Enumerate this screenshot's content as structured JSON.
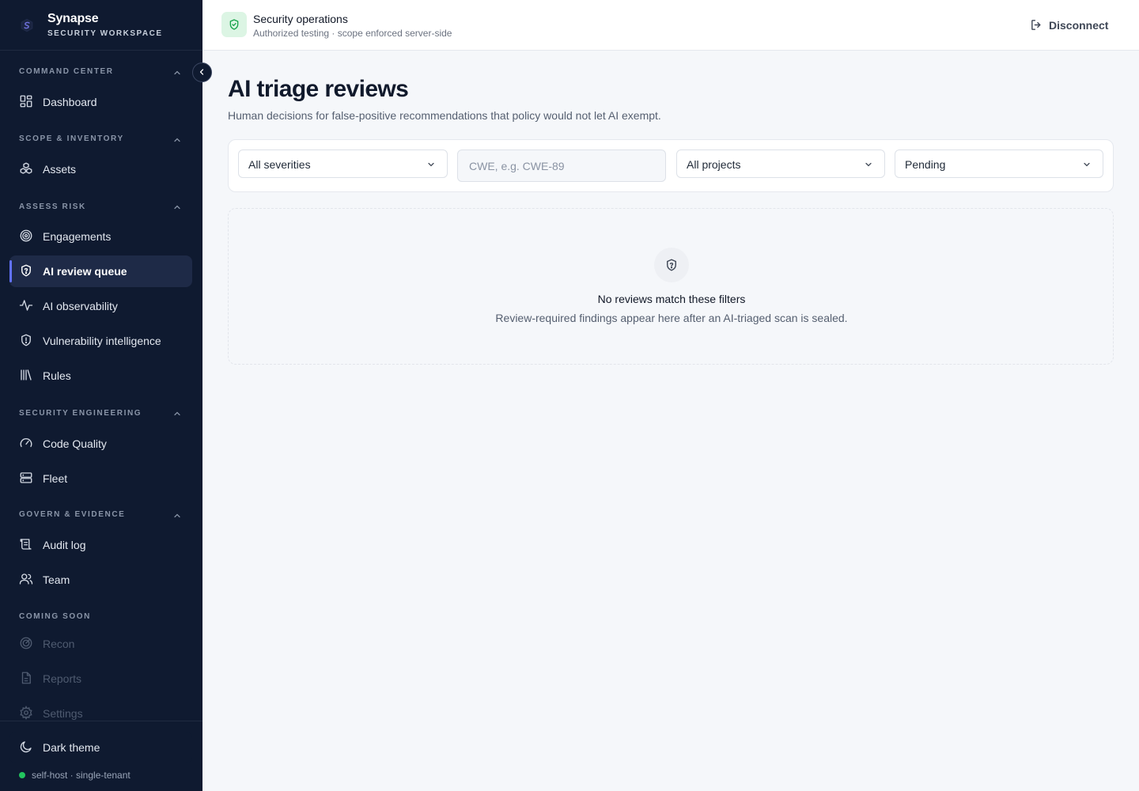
{
  "brand": {
    "name": "Synapse",
    "subtitle": "SECURITY WORKSPACE"
  },
  "sidebar": {
    "sections": [
      {
        "label": "COMMAND CENTER",
        "items": [
          {
            "label": "Dashboard",
            "icon": "dashboard-icon"
          }
        ]
      },
      {
        "label": "SCOPE & INVENTORY",
        "items": [
          {
            "label": "Assets",
            "icon": "boxes-icon"
          }
        ]
      },
      {
        "label": "ASSESS RISK",
        "items": [
          {
            "label": "Engagements",
            "icon": "target-icon"
          },
          {
            "label": "AI review queue",
            "icon": "shield-question-icon",
            "active": true
          },
          {
            "label": "AI observability",
            "icon": "activity-icon"
          },
          {
            "label": "Vulnerability intelligence",
            "icon": "shield-alert-icon"
          },
          {
            "label": "Rules",
            "icon": "library-icon"
          }
        ]
      },
      {
        "label": "SECURITY ENGINEERING",
        "items": [
          {
            "label": "Code Quality",
            "icon": "gauge-icon"
          },
          {
            "label": "Fleet",
            "icon": "server-icon"
          }
        ]
      },
      {
        "label": "GOVERN & EVIDENCE",
        "items": [
          {
            "label": "Audit log",
            "icon": "scroll-icon"
          },
          {
            "label": "Team",
            "icon": "users-icon"
          }
        ]
      },
      {
        "label": "COMING SOON",
        "items": [
          {
            "label": "Recon",
            "icon": "radar-icon",
            "disabled": true
          },
          {
            "label": "Reports",
            "icon": "file-text-icon",
            "disabled": true
          },
          {
            "label": "Settings",
            "icon": "gear-icon",
            "disabled": true
          }
        ]
      }
    ],
    "theme_toggle": "Dark theme",
    "status": "self-host · single-tenant",
    "status_color": "#22c55e",
    "accent_color": "#6272ff"
  },
  "topbar": {
    "title": "Security operations",
    "subtitle": "Authorized testing · scope enforced server-side",
    "disconnect": "Disconnect"
  },
  "main": {
    "title": "AI triage reviews",
    "subtitle": "Human decisions for false-positive recommendations that policy would not let AI exempt.",
    "filters": {
      "severity": "All severities",
      "cwe_placeholder": "CWE, e.g. CWE-89",
      "cwe_value": "",
      "project": "All projects",
      "status": "Pending"
    },
    "empty": {
      "title": "No reviews match these filters",
      "subtitle": "Review-required findings appear here after an AI-triaged scan is sealed."
    }
  }
}
